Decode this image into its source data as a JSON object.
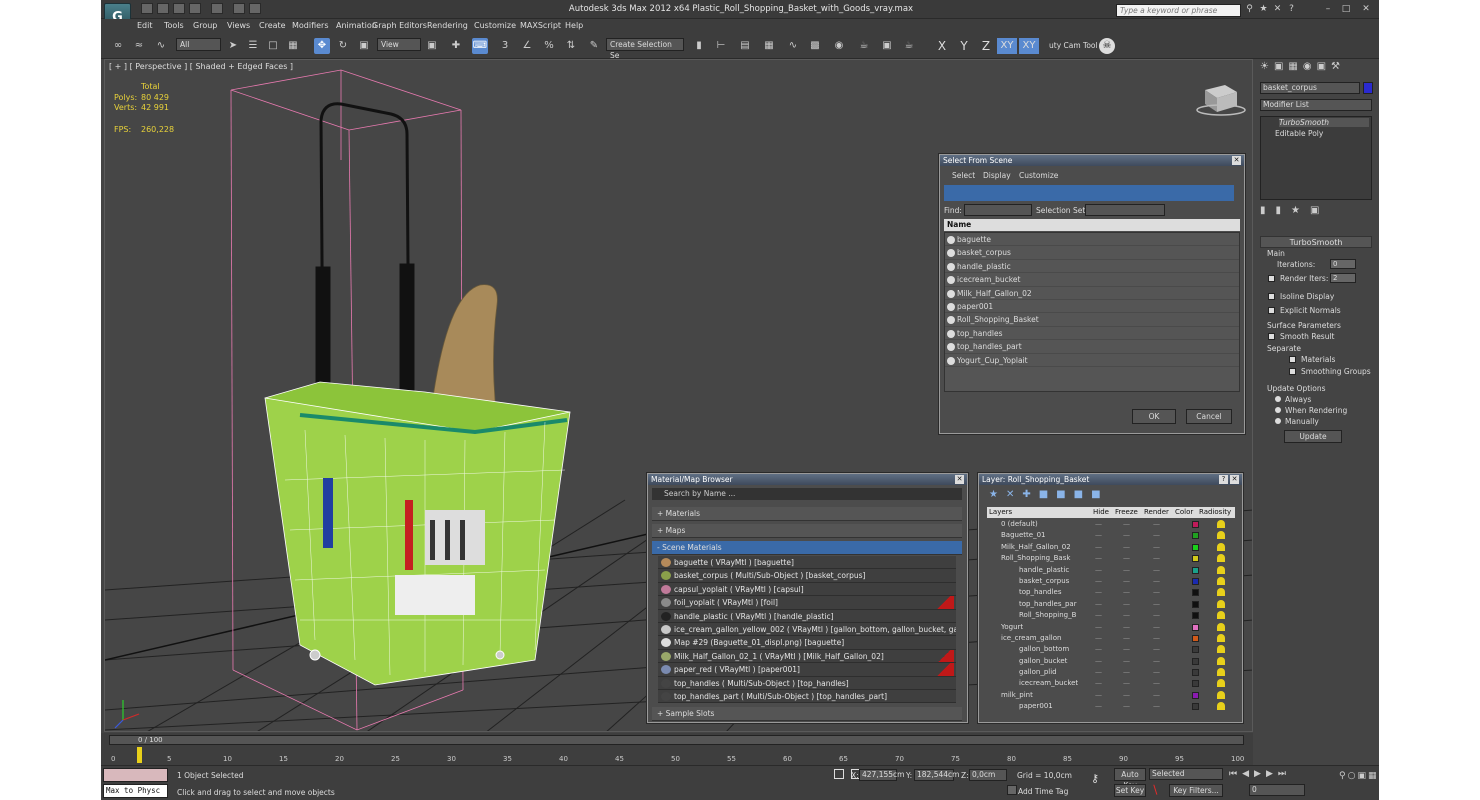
{
  "app": {
    "title": "Autodesk 3ds Max  2012 x64     Plastic_Roll_Shopping_Basket_with_Goods_vray.max",
    "logo": "G",
    "search_placeholder": "Type a keyword or phrase"
  },
  "menu": [
    "Edit",
    "Tools",
    "Group",
    "Views",
    "Create",
    "Modifiers",
    "Animation",
    "Graph Editors",
    "Rendering",
    "Customize",
    "MAXScript",
    "Help"
  ],
  "toolbar": {
    "selection_filter": "All",
    "ref_coord": "View",
    "named_selection": "Create Selection Se",
    "axes": [
      "X",
      "Y",
      "Z",
      "XY",
      "XY"
    ],
    "cam_tool": "uty Cam Tool \\"
  },
  "viewport": {
    "label": "[ + ] [ Perspective ] [ Shaded + Edged Faces ]",
    "stats_header": "Total",
    "polys_label": "Polys:",
    "polys": "80 429",
    "verts_label": "Verts:",
    "verts": "42 991",
    "fps_label": "FPS:",
    "fps": "260,228"
  },
  "select_from_scene": {
    "title": "Select From Scene",
    "tabs": [
      "Select",
      "Display",
      "Customize"
    ],
    "find_label": "Find:",
    "selection_set_label": "Selection Set:",
    "column": "Name",
    "items": [
      "baguette",
      "basket_corpus",
      "handle_plastic",
      "icecream_bucket",
      "Milk_Half_Gallon_02",
      "paper001",
      "Roll_Shopping_Basket",
      "top_handles",
      "top_handles_part",
      "Yogurt_Cup_Yoplait"
    ],
    "ok": "OK",
    "cancel": "Cancel"
  },
  "material_browser": {
    "title": "Material/Map Browser",
    "search": "Search by Name ...",
    "sections": {
      "materials": "+ Materials",
      "maps": "+ Maps",
      "scene": "- Scene Materials",
      "sample": "+ Sample Slots"
    },
    "rows": [
      {
        "text": "baguette  ( VRayMtl ) [baguette]",
        "red": false,
        "color": "#b58a5a"
      },
      {
        "text": "basket_corpus  ( Multi/Sub-Object ) [basket_corpus]",
        "red": false,
        "color": "#8aa04a"
      },
      {
        "text": "capsul_yoplait  ( VRayMtl ) [capsul]",
        "red": false,
        "color": "#c07a9a"
      },
      {
        "text": "foil_yoplait  ( VRayMtl ) [foil]",
        "red": true,
        "color": "#8a8a8a"
      },
      {
        "text": "handle_plastic  ( VRayMtl ) [handle_plastic]",
        "red": false,
        "color": "#222222"
      },
      {
        "text": "ice_cream_gallon_yellow_002  ( VRayMtl ) [gallon_bottom, gallon_bucket, gallo...",
        "red": false,
        "color": "#c8c8c8"
      },
      {
        "text": "Map #29 (Baguette_01_displ.png) [baguette]",
        "red": false,
        "color": "#dddddd"
      },
      {
        "text": "Milk_Half_Gallon_02_1  ( VRayMtl ) [Milk_Half_Gallon_02]",
        "red": true,
        "color": "#9aa86a"
      },
      {
        "text": "paper_red  ( VRayMtl ) [paper001]",
        "red": true,
        "color": "#7a8ab0"
      },
      {
        "text": "top_handles  ( Multi/Sub-Object ) [top_handles]",
        "red": false,
        "color": "#444444"
      },
      {
        "text": "top_handles_part  ( Multi/Sub-Object ) [top_handles_part]",
        "red": false,
        "color": "#444444"
      }
    ]
  },
  "layer_panel": {
    "title": "Layer: Roll_Shopping_Basket",
    "columns": [
      "Layers",
      "Hide",
      "Freeze",
      "Render",
      "Color",
      "Radiosity"
    ],
    "rows": [
      {
        "name": "0 (default)",
        "indent": 0,
        "color": "#c01a5a"
      },
      {
        "name": "Baguette_01",
        "indent": 0,
        "color": "#20a020"
      },
      {
        "name": "Milk_Half_Gallon_02",
        "indent": 0,
        "color": "#1ad01a"
      },
      {
        "name": "Roll_Shopping_Bask",
        "indent": 0,
        "color": "#d0c81a"
      },
      {
        "name": "handle_plastic",
        "indent": 1,
        "color": "#1aa08a"
      },
      {
        "name": "basket_corpus",
        "indent": 1,
        "color": "#1a2ab0"
      },
      {
        "name": "top_handles",
        "indent": 1,
        "color": "#101010"
      },
      {
        "name": "top_handles_par",
        "indent": 1,
        "color": "#101010"
      },
      {
        "name": "Roll_Shopping_B",
        "indent": 1,
        "color": "#101010"
      },
      {
        "name": "Yogurt",
        "indent": 0,
        "color": "#e070c0"
      },
      {
        "name": "ice_cream_gallon",
        "indent": 0,
        "color": "#d05a1a"
      },
      {
        "name": "gallon_bottom",
        "indent": 1,
        "color": "#3a3a3a"
      },
      {
        "name": "gallon_bucket",
        "indent": 1,
        "color": "#3a3a3a"
      },
      {
        "name": "gallon_plid",
        "indent": 1,
        "color": "#3a3a3a"
      },
      {
        "name": "icecream_bucket",
        "indent": 1,
        "color": "#3a3a3a"
      },
      {
        "name": "milk_pint",
        "indent": 0,
        "color": "#8a1ab0"
      },
      {
        "name": "paper001",
        "indent": 1,
        "color": "#3a3a3a"
      }
    ]
  },
  "command_panel": {
    "object_name": "basket_corpus",
    "modifier_list": "Modifier List",
    "stack": [
      "TurboSmooth",
      "Editable Poly"
    ],
    "rollout_title": "TurboSmooth",
    "main": "Main",
    "iterations_label": "Iterations:",
    "iterations": "0",
    "render_iters_label": "Render Iters:",
    "render_iters": "2",
    "isoline": "Isoline Display",
    "explicit_normals": "Explicit Normals",
    "surface_params": "Surface Parameters",
    "smooth_result": "Smooth Result",
    "separate": "Separate",
    "materials": "Materials",
    "smoothing_groups": "Smoothing Groups",
    "update_options": "Update Options",
    "always": "Always",
    "when_rendering": "When Rendering",
    "manually": "Manually",
    "update_btn": "Update"
  },
  "timeline": {
    "frame": "0 / 100",
    "ticks": [
      "0",
      "5",
      "10",
      "15",
      "20",
      "25",
      "30",
      "35",
      "40",
      "45",
      "50",
      "55",
      "60",
      "65",
      "70",
      "75",
      "80",
      "85",
      "90",
      "95",
      "100"
    ]
  },
  "status": {
    "maxscript": "Max to Physc",
    "selected": "1 Object Selected",
    "prompt": "Click and drag to select and move objects",
    "x_label": "X:",
    "x": "427,155cm",
    "y_label": "Y:",
    "y": "182,544cm",
    "z_label": "Z:",
    "z": "0,0cm",
    "grid": "Grid = 10,0cm",
    "add_time_tag": "Add Time Tag",
    "auto_key": "Auto Key",
    "set_key": "Set Key",
    "key_mode": "Selected",
    "key_filters": "Key Filters...",
    "frame_field": "0"
  }
}
